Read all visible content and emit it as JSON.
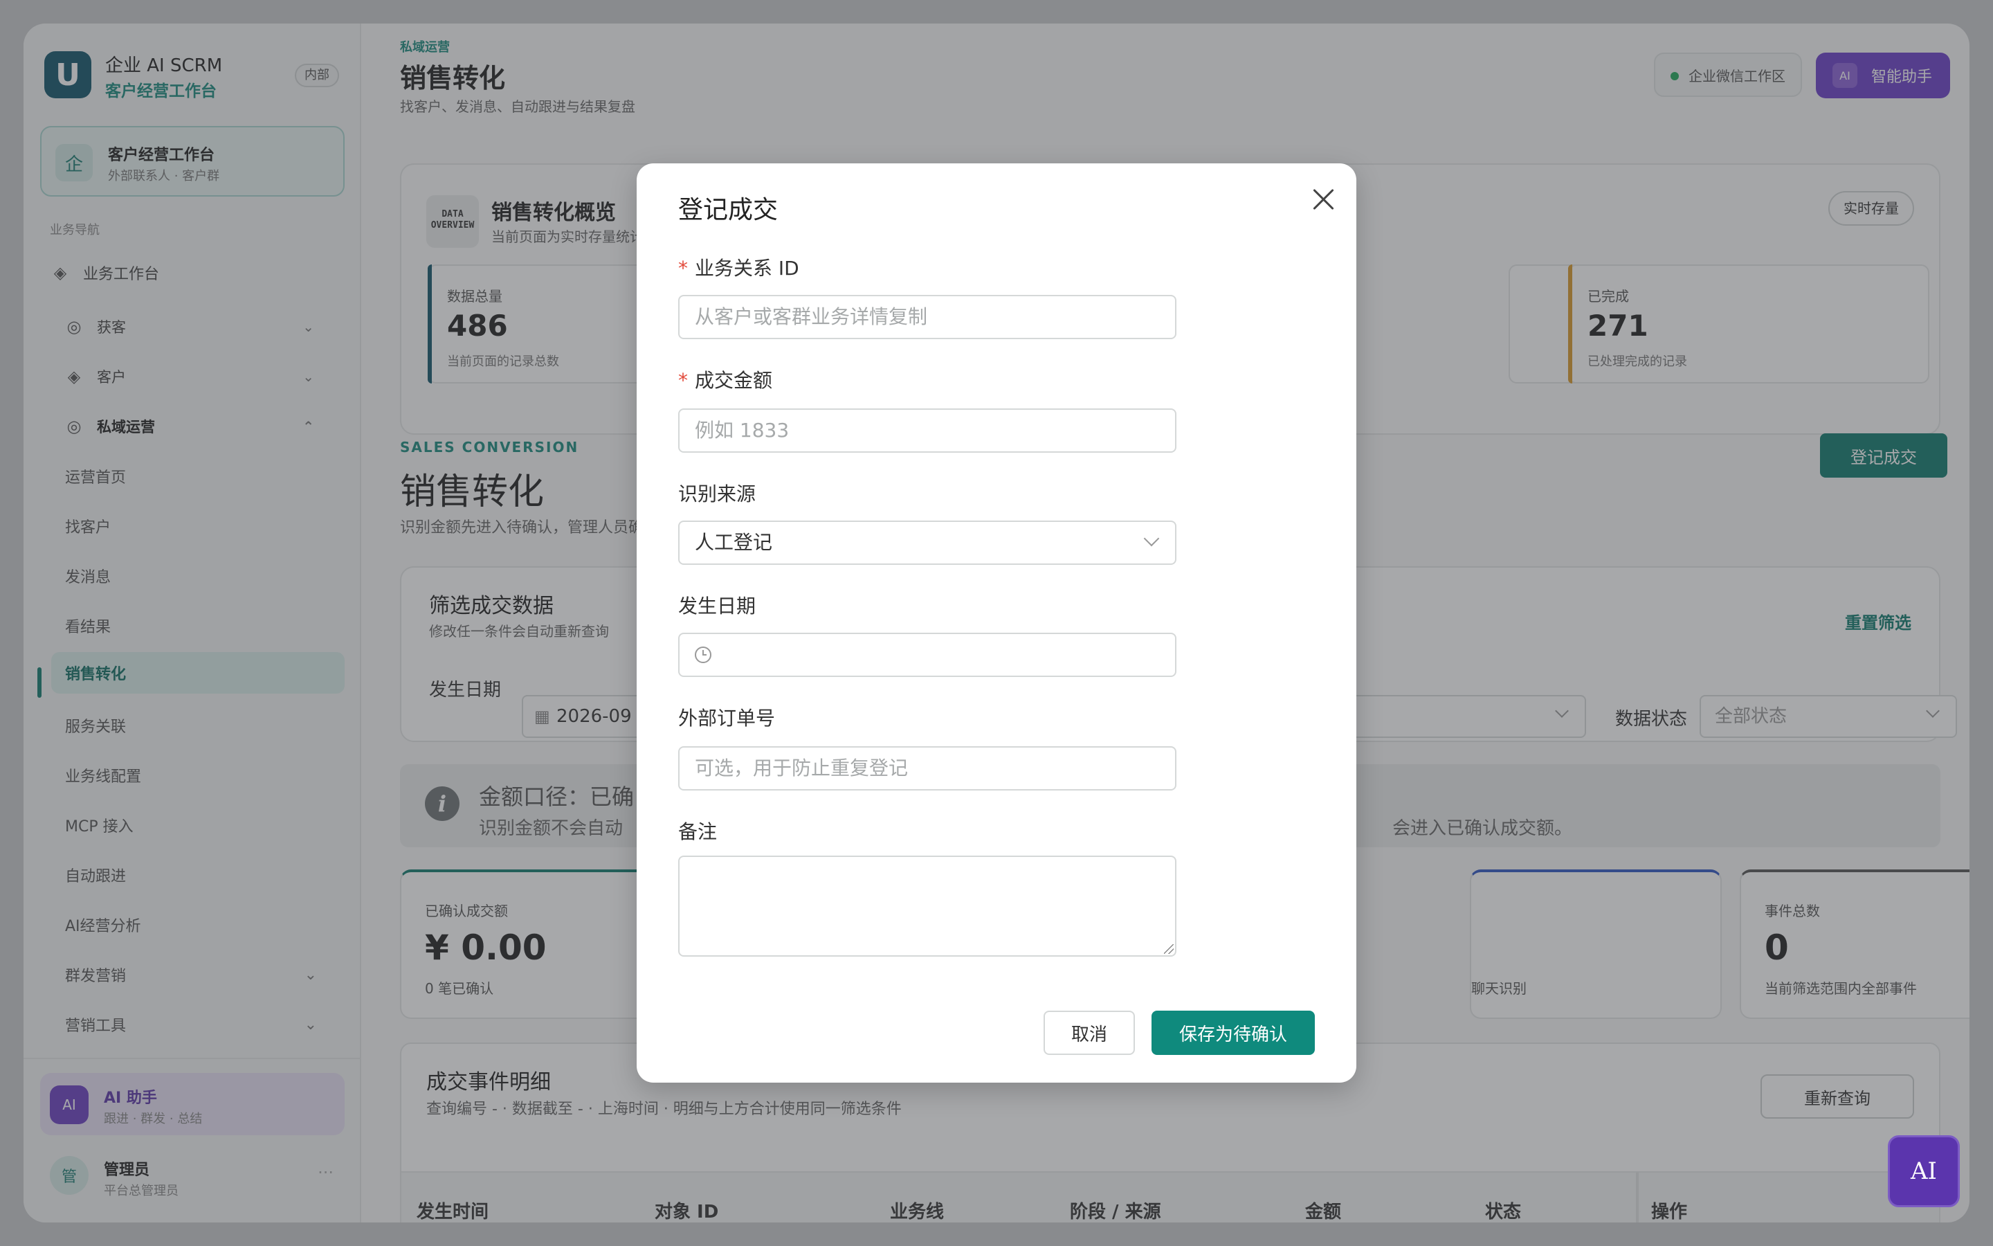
{
  "sidebar": {
    "brand_title": "企业 AI SCRM",
    "brand_sub": "客户经营工作台",
    "badge": "内部",
    "workspace": {
      "icon": "企",
      "title": "客户经营工作台",
      "sub": "外部联系人 · 客户群"
    },
    "section": "业务导航",
    "items": [
      {
        "label": "业务工作台",
        "icon": "layers-icon"
      },
      {
        "label": "获客",
        "icon": "target-icon"
      },
      {
        "label": "客户",
        "icon": "layers-icon"
      },
      {
        "label": "私域运营",
        "icon": "target-icon"
      }
    ],
    "sub_items": [
      "运营首页",
      "找客户",
      "发消息",
      "看结果",
      "销售转化",
      "服务关联",
      "业务线配置",
      "MCP 接入",
      "自动跟进",
      "AI经营分析",
      "群发营销",
      "营销工具"
    ],
    "active_item": "销售转化",
    "ai": {
      "avatar": "AI",
      "title": "AI 助手",
      "sub": "跟进 · 群发 · 总结"
    },
    "user": {
      "avatar": "管",
      "name": "管理员",
      "sub": "平台总管理员",
      "more": "···"
    }
  },
  "header": {
    "breadcrumb": "私域运营",
    "title": "销售转化",
    "desc": "找客户、发消息、自动跟进与结果复盘",
    "workspace_badge": "企业微信工作区",
    "ai_button": "智能助手",
    "ai_mini": "AI"
  },
  "overview": {
    "badge_text": "DATA OVERVIEW",
    "title": "销售转化概览",
    "sub": "当前页面为实时存量统计",
    "live_tag": "实时存量",
    "stats": [
      {
        "label": "数据总量",
        "value": "486",
        "caption": "当前页面的记录总数",
        "color": "#12556a"
      },
      {
        "label": "已完成",
        "value": "271",
        "caption": "已处理完成的记录",
        "color": "#d99a2b"
      }
    ]
  },
  "section": {
    "eyebrow": "SALES CONVERSION",
    "title": "销售转化",
    "desc": "识别金额先进入待确认，管理人员确认后进入已确认成交额。",
    "register_button": "登记成交"
  },
  "filter": {
    "title": "筛选成交数据",
    "sub": "修改任一条件会自动重新查询",
    "reset": "重置筛选",
    "date_label": "发生日期",
    "date_value": "2026-09",
    "status_label": "数据状态",
    "status_value": "全部状态"
  },
  "info": {
    "line1": "金额口径：已确",
    "line2": "识别金额不会自动",
    "line3": "会进入已确认成交额。"
  },
  "kpis": [
    {
      "label": "已确认成交额",
      "value": "¥ 0.00",
      "caption": "0 笔已确认"
    },
    {
      "label": "",
      "value": "",
      "caption": "聊天识别"
    },
    {
      "label": "事件总数",
      "value": "0",
      "caption": "当前筛选范围内全部事件"
    }
  ],
  "table": {
    "title": "成交事件明细",
    "sub": "查询编号 - · 数据截至 - · 上海时间 · 明细与上方合计使用同一筛选条件",
    "requery": "重新查询",
    "columns": [
      "发生时间",
      "对象 ID",
      "业务线",
      "阶段 / 来源",
      "金额",
      "状态",
      "操作"
    ]
  },
  "modal": {
    "title": "登记成交",
    "fields": {
      "relation_id": {
        "label": "业务关系 ID",
        "required": "*",
        "placeholder": "从客户或客群业务详情复制"
      },
      "amount": {
        "label": "成交金额",
        "required": "*",
        "placeholder": "例如 1833"
      },
      "source": {
        "label": "识别来源",
        "value": "人工登记"
      },
      "date": {
        "label": "发生日期"
      },
      "order_no": {
        "label": "外部订单号",
        "placeholder": "可选，用于防止重复登记"
      },
      "note": {
        "label": "备注"
      }
    },
    "cancel": "取消",
    "save": "保存为待确认"
  },
  "ai_float": "AI",
  "colors": {
    "accent": "#0f7a6d",
    "ai_purple": "#6b3fc8"
  }
}
